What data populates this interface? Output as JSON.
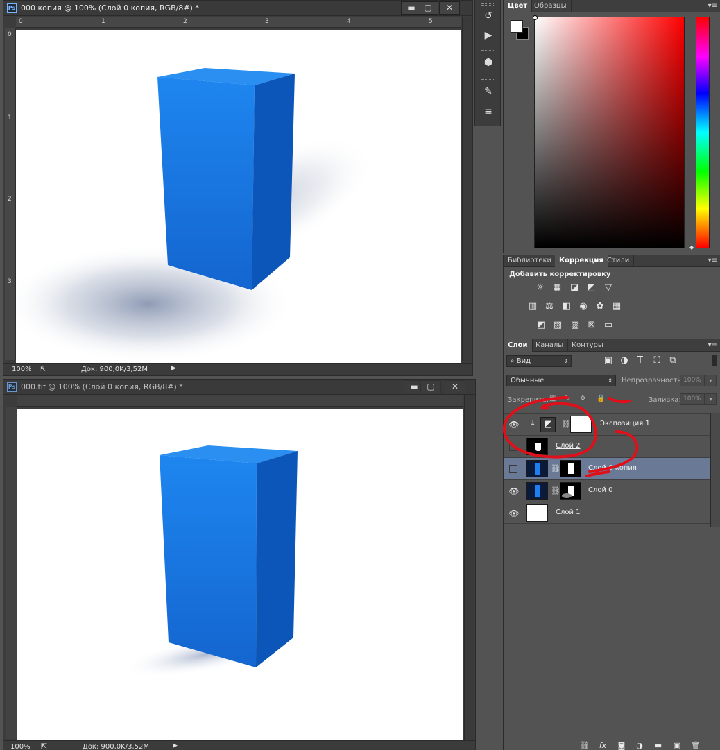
{
  "doc1": {
    "title": "000 копия @ 100% (Слой 0 копия, RGB/8#) *",
    "ruler_h": [
      "0",
      "1",
      "2",
      "3",
      "4",
      "5"
    ],
    "ruler_v": [
      "0",
      "1",
      "2",
      "3"
    ],
    "zoom": "100%",
    "doc_size": "Док: 900,0K/3,52M"
  },
  "doc2": {
    "title": "000.tif @ 100% (Слой 0 копия, RGB/8#) *",
    "zoom": "100%",
    "doc_size": "Док: 900,0K/3,52M"
  },
  "window_buttons": {
    "minimize": "▬",
    "restore": "▢",
    "close": "✕"
  },
  "colors": {
    "cube_front": "#1a7de6",
    "cube_side": "#0a52b3",
    "cube_top": "#2a8ff0",
    "selected_layer": "#6a7a96",
    "annotation": "#e0101a"
  },
  "color_panel": {
    "tabs": [
      "Цвет",
      "Образцы"
    ],
    "foreground": "#ffffff",
    "background": "#000000"
  },
  "adjust_panel": {
    "tabs": [
      "Библиотеки",
      "Коррекция",
      "Стили"
    ],
    "heading": "Добавить корректировку",
    "icons": [
      "brightness-icon",
      "levels-icon",
      "curves-icon",
      "exposure-icon",
      "vibrance-icon",
      "hue-icon",
      "color-balance-icon",
      "bw-icon",
      "photo-filter-icon",
      "channel-mixer-icon",
      "color-lookup-icon",
      "invert-icon",
      "posterize-icon",
      "threshold-icon",
      "gradient-map-icon",
      "selective-color-icon"
    ]
  },
  "layers_panel": {
    "tabs": [
      "Слои",
      "Каналы",
      "Контуры"
    ],
    "filter": "Вид",
    "blend_mode": "Обычные",
    "opacity_label": "Непрозрачность:",
    "opacity_value": "100%",
    "lock_label": "Закрепить:",
    "fill_label": "Заливка:",
    "fill_value": "100%",
    "layers": [
      {
        "name": "Экспозиция 1",
        "visible": true,
        "selected": false
      },
      {
        "name": "Слой 2",
        "visible": false,
        "selected": false
      },
      {
        "name": "Слой 0 копия",
        "visible": false,
        "selected": true
      },
      {
        "name": "Слой 0",
        "visible": true,
        "selected": false
      },
      {
        "name": "Слой 1",
        "visible": true,
        "selected": false
      }
    ],
    "bottom_icons": [
      "link-icon",
      "fx-icon",
      "mask-icon",
      "adjustment-icon",
      "folder-icon",
      "new-layer-icon",
      "trash-icon"
    ]
  }
}
